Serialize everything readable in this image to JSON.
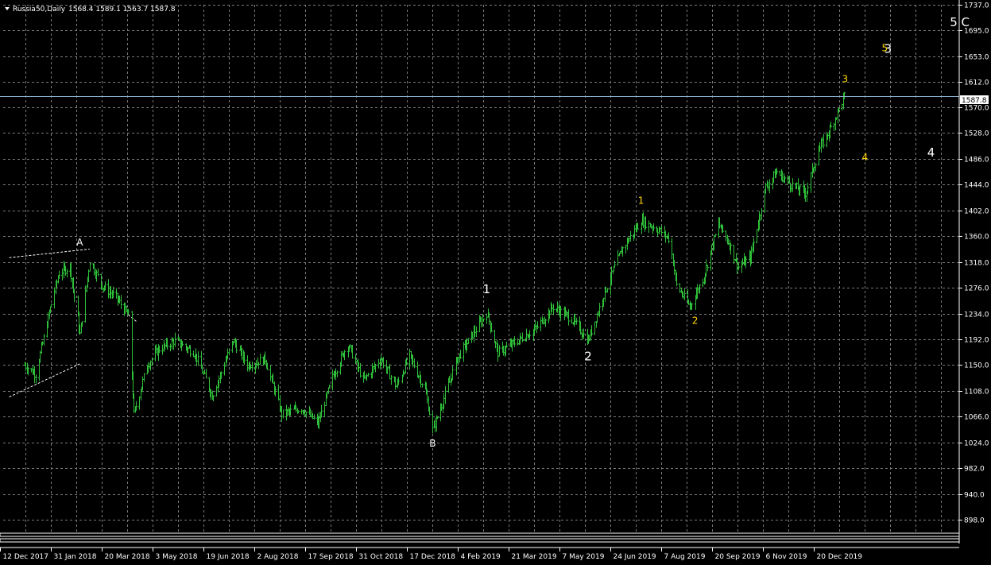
{
  "header": {
    "symbol_label": "Russia50,Daily",
    "ohlc_label": "1568.4 1589.1 1563.7 1587.8"
  },
  "current_price_label": "1587.8",
  "colors": {
    "background": "#000000",
    "grid": "#7a7a7a",
    "candle": "#2fbf3a",
    "axis_text": "#ffffff",
    "price_line": "#8fb7d6",
    "wave_white": "#ffffff",
    "wave_yellow": "#ffd400",
    "trendline": "#ffffff"
  },
  "chart_data": {
    "type": "ohlc",
    "symbol": "Russia50",
    "timeframe": "Daily",
    "last": {
      "open": 1568.4,
      "high": 1589.1,
      "low": 1563.7,
      "close": 1587.8
    },
    "ylim": [
      880,
      1737
    ],
    "y_ticks": [
      "1737.0",
      "1695.0",
      "1653.0",
      "1612.0",
      "1570.0",
      "1528.0",
      "1486.0",
      "1444.0",
      "1402.0",
      "1360.0",
      "1318.0",
      "1276.0",
      "1234.0",
      "1192.0",
      "1150.0",
      "1108.0",
      "1066.0",
      "1024.0",
      "982.0",
      "940.0",
      "898.0"
    ],
    "x_ticks": [
      "12 Dec 2017",
      "31 Jan 2018",
      "20 Mar 2018",
      "3 May 2018",
      "19 Jun 2018",
      "2 Aug 2018",
      "17 Sep 2018",
      "31 Oct 2018",
      "17 Dec 2018",
      "4 Feb 2019",
      "21 Mar 2019",
      "7 May 2019",
      "24 Jun 2019",
      "7 Aug 2019",
      "20 Sep 2019",
      "6 Nov 2019",
      "20 Dec 2019"
    ],
    "grid": true,
    "price_path": [
      {
        "date": "2017-12-12",
        "price": 1150
      },
      {
        "date": "2017-12-22",
        "price": 1135
      },
      {
        "date": "2018-01-03",
        "price": 1235
      },
      {
        "date": "2018-01-12",
        "price": 1300
      },
      {
        "date": "2018-01-22",
        "price": 1310
      },
      {
        "date": "2018-01-31",
        "price": 1200
      },
      {
        "date": "2018-02-09",
        "price": 1320
      },
      {
        "date": "2018-02-20",
        "price": 1280
      },
      {
        "date": "2018-03-05",
        "price": 1260
      },
      {
        "date": "2018-03-16",
        "price": 1230
      },
      {
        "date": "2018-03-21",
        "price": 1070
      },
      {
        "date": "2018-04-02",
        "price": 1150
      },
      {
        "date": "2018-04-12",
        "price": 1175
      },
      {
        "date": "2018-04-27",
        "price": 1190
      },
      {
        "date": "2018-05-15",
        "price": 1170
      },
      {
        "date": "2018-05-31",
        "price": 1100
      },
      {
        "date": "2018-06-19",
        "price": 1190
      },
      {
        "date": "2018-07-02",
        "price": 1150
      },
      {
        "date": "2018-07-18",
        "price": 1160
      },
      {
        "date": "2018-08-02",
        "price": 1070
      },
      {
        "date": "2018-08-20",
        "price": 1080
      },
      {
        "date": "2018-09-04",
        "price": 1055
      },
      {
        "date": "2018-09-17",
        "price": 1130
      },
      {
        "date": "2018-10-01",
        "price": 1185
      },
      {
        "date": "2018-10-15",
        "price": 1125
      },
      {
        "date": "2018-10-31",
        "price": 1160
      },
      {
        "date": "2018-11-14",
        "price": 1115
      },
      {
        "date": "2018-11-26",
        "price": 1165
      },
      {
        "date": "2018-12-10",
        "price": 1110
      },
      {
        "date": "2018-12-17",
        "price": 1045
      },
      {
        "date": "2018-12-24",
        "price": 1080
      },
      {
        "date": "2019-01-08",
        "price": 1160
      },
      {
        "date": "2019-01-22",
        "price": 1200
      },
      {
        "date": "2019-02-04",
        "price": 1235
      },
      {
        "date": "2019-02-14",
        "price": 1170
      },
      {
        "date": "2019-02-28",
        "price": 1185
      },
      {
        "date": "2019-03-21",
        "price": 1210
      },
      {
        "date": "2019-04-05",
        "price": 1245
      },
      {
        "date": "2019-04-22",
        "price": 1225
      },
      {
        "date": "2019-05-07",
        "price": 1190
      },
      {
        "date": "2019-05-22",
        "price": 1270
      },
      {
        "date": "2019-06-07",
        "price": 1340
      },
      {
        "date": "2019-06-24",
        "price": 1385
      },
      {
        "date": "2019-07-10",
        "price": 1370
      },
      {
        "date": "2019-07-20",
        "price": 1355
      },
      {
        "date": "2019-07-26",
        "price": 1280
      },
      {
        "date": "2019-08-07",
        "price": 1245
      },
      {
        "date": "2019-08-19",
        "price": 1290
      },
      {
        "date": "2019-09-02",
        "price": 1380
      },
      {
        "date": "2019-09-10",
        "price": 1355
      },
      {
        "date": "2019-09-20",
        "price": 1310
      },
      {
        "date": "2019-10-01",
        "price": 1325
      },
      {
        "date": "2019-10-15",
        "price": 1440
      },
      {
        "date": "2019-10-25",
        "price": 1465
      },
      {
        "date": "2019-11-06",
        "price": 1445
      },
      {
        "date": "2019-11-20",
        "price": 1430
      },
      {
        "date": "2019-12-02",
        "price": 1500
      },
      {
        "date": "2019-12-14",
        "price": 1540
      },
      {
        "date": "2019-12-25",
        "price": 1587.8
      }
    ],
    "wave_labels": [
      {
        "text": "A",
        "date": "2018-01-31",
        "price": 1345,
        "color": "white",
        "size": "sm"
      },
      {
        "text": "B",
        "date": "2018-12-17",
        "price": 1017,
        "color": "white",
        "size": "sm"
      },
      {
        "text": "1",
        "date": "2019-02-04",
        "price": 1267,
        "color": "white",
        "size": "md"
      },
      {
        "text": "2",
        "date": "2019-05-07",
        "price": 1158,
        "color": "white",
        "size": "md"
      },
      {
        "text": "1",
        "date": "2019-06-24",
        "price": 1413,
        "color": "yellow",
        "size": "sm"
      },
      {
        "text": "2",
        "date": "2019-08-12",
        "price": 1217,
        "color": "yellow",
        "size": "sm"
      },
      {
        "text": "3",
        "date": "2019-12-26",
        "price": 1611,
        "color": "yellow",
        "size": "sm"
      },
      {
        "text": "5",
        "date": "2020-01-31",
        "price": 1661,
        "color": "yellow",
        "size": "sm"
      },
      {
        "text": "3",
        "date": "2020-02-03",
        "price": 1659,
        "color": "white",
        "size": "md"
      },
      {
        "text": "4",
        "date": "2020-01-13",
        "price": 1483,
        "color": "yellow",
        "size": "sm"
      },
      {
        "text": "4",
        "date": "2020-03-13",
        "price": 1490,
        "color": "white",
        "size": "md"
      },
      {
        "text": "5 C",
        "date": "2020-04-08",
        "price": 1702,
        "color": "white",
        "size": "md"
      }
    ],
    "trendlines": [
      {
        "from": {
          "date": "2017-11-28",
          "price": 1325
        },
        "to": {
          "date": "2018-02-09",
          "price": 1339
        }
      },
      {
        "from": {
          "date": "2017-11-28",
          "price": 1098
        },
        "to": {
          "date": "2018-01-31",
          "price": 1152
        }
      },
      {
        "from": {
          "date": "2018-03-16",
          "price": 1232
        },
        "to": {
          "date": "2018-03-24",
          "price": 1220
        }
      }
    ]
  }
}
